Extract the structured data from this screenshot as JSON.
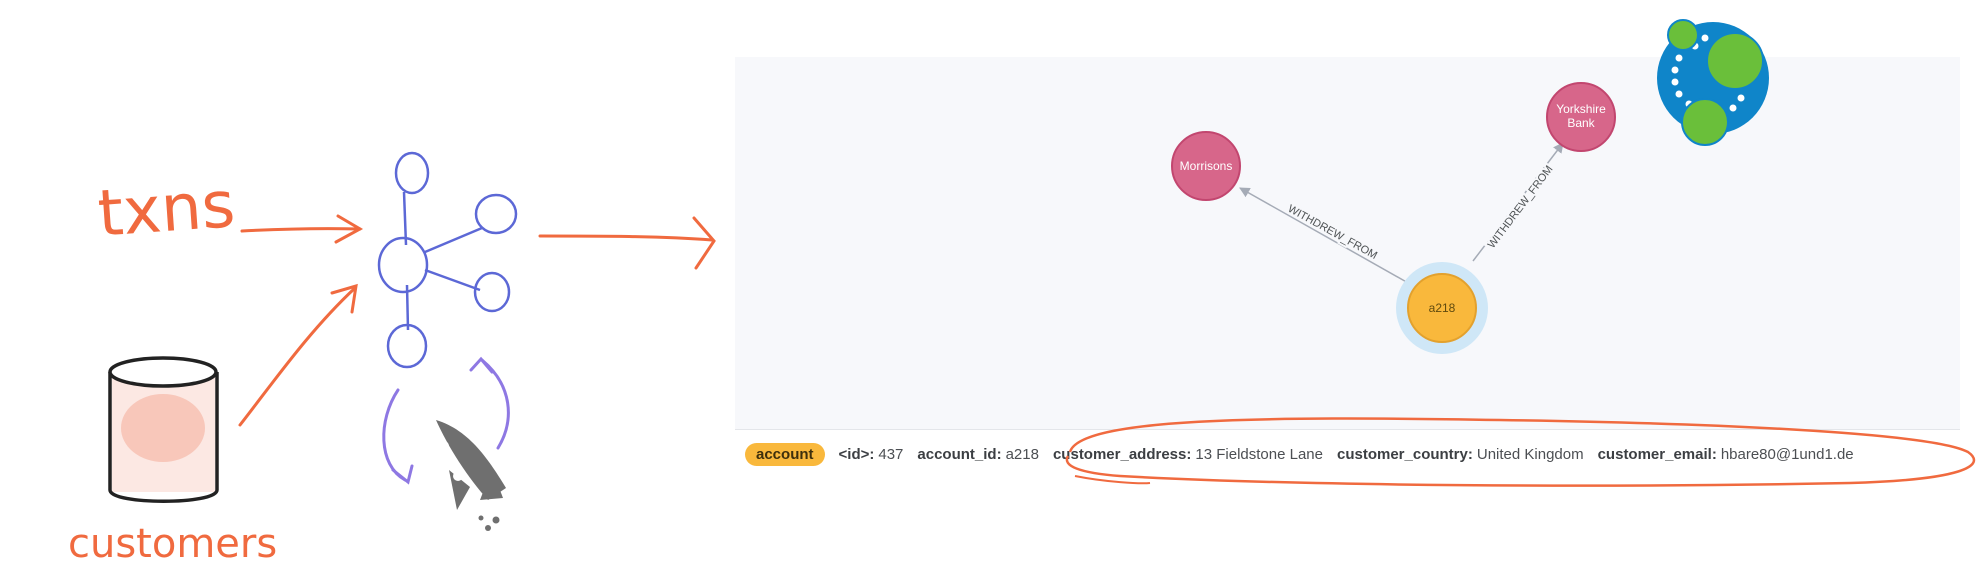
{
  "sketch": {
    "input_label": "txns",
    "database_label": "customers"
  },
  "graph": {
    "nodes": [
      {
        "id": "morrisons",
        "label": "Morrisons",
        "color": "#d7668a"
      },
      {
        "id": "yorkshire",
        "label_lines": [
          "Yorkshire",
          "Bank"
        ],
        "color": "#d7668a"
      },
      {
        "id": "a218",
        "label": "a218",
        "color": "#f9b83c",
        "selected": true
      }
    ],
    "relationships": [
      {
        "from": "a218",
        "to": "morrisons",
        "type": "WITHDREW_FROM"
      },
      {
        "from": "a218",
        "to": "yorkshire",
        "type": "WITHDREW_FROM"
      }
    ]
  },
  "details": {
    "label": "account",
    "properties": [
      {
        "key": "<id>:",
        "value": "437"
      },
      {
        "key": "account_id:",
        "value": "a218"
      },
      {
        "key": "customer_address:",
        "value": "13 Fieldstone Lane"
      },
      {
        "key": "customer_country:",
        "value": "United Kingdom"
      },
      {
        "key": "customer_email:",
        "value": "hbare80@1und1.de"
      }
    ]
  },
  "colors": {
    "annotation": "#f06a3f",
    "sketch_graph": "#5c68d6",
    "selection_ring": "#cfe7f7",
    "logo_blue": "#0f85c9",
    "logo_green": "#6abf3a"
  }
}
